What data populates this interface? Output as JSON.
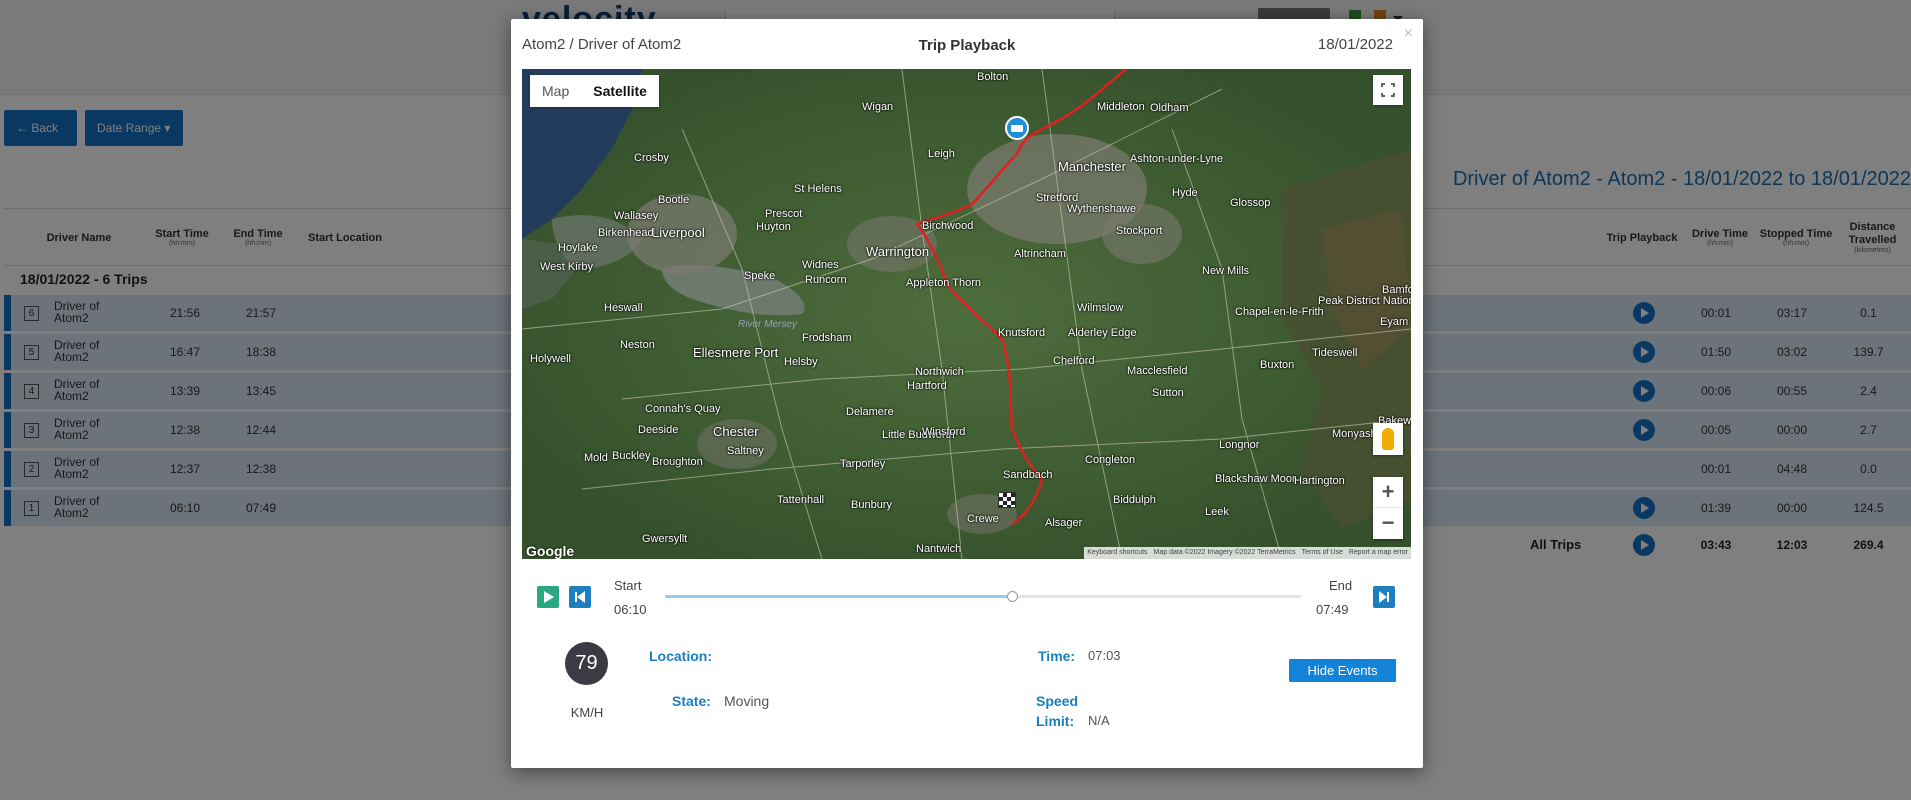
{
  "background": {
    "logo": "velocity",
    "top_button": "Logout",
    "back_button": "Back",
    "back_icon": "arrow-left-icon",
    "date_range_button": "Date Range",
    "report_title": "Driver of Atom2 - Atom2 - 18/01/2022 to 18/01/2022",
    "columns": {
      "driver_name": "Driver Name",
      "start_time": "Start Time",
      "end_time": "End Time",
      "time_unit": "(hh:mm)",
      "start_location": "Start Location",
      "trip_playback": "Trip Playback",
      "drive_time": "Drive Time",
      "stopped_time": "Stopped Time",
      "distance": "Distance Travelled",
      "distance_unit": "(kilometres)"
    },
    "group_label": "18/01/2022 - 6 Trips",
    "trips": [
      {
        "num": "6",
        "driver": "Driver of Atom2",
        "start": "21:56",
        "end": "21:57",
        "drive": "00:01",
        "stopped": "03:17",
        "distance": "0.1"
      },
      {
        "num": "5",
        "driver": "Driver of Atom2",
        "start": "16:47",
        "end": "18:38",
        "drive": "01:50",
        "stopped": "03:02",
        "distance": "139.7"
      },
      {
        "num": "4",
        "driver": "Driver of Atom2",
        "start": "13:39",
        "end": "13:45",
        "drive": "00:06",
        "stopped": "00:55",
        "distance": "2.4"
      },
      {
        "num": "3",
        "driver": "Driver of Atom2",
        "start": "12:38",
        "end": "12:44",
        "drive": "00:05",
        "stopped": "00:00",
        "distance": "2.7"
      },
      {
        "num": "2",
        "driver": "Driver of Atom2",
        "start": "12:37",
        "end": "12:38",
        "drive": "00:01",
        "stopped": "04:48",
        "distance": "0.0"
      },
      {
        "num": "1",
        "driver": "Driver of Atom2",
        "start": "06:10",
        "end": "07:49",
        "drive": "01:39",
        "stopped": "00:00",
        "distance": "124.5"
      }
    ],
    "totals": {
      "label": "All Trips",
      "drive": "03:43",
      "stopped": "12:03",
      "distance": "269.4"
    }
  },
  "modal": {
    "subtitle": "Atom2 / Driver of Atom2",
    "title": "Trip Playback",
    "date": "18/01/2022",
    "close_icon": "×",
    "map": {
      "toggle_map": "Map",
      "toggle_satellite": "Satellite",
      "active_view": "Satellite",
      "google_label": "Google",
      "attribution": {
        "shortcuts": "Keyboard shortcuts",
        "imagery": "Map data ©2022 Imagery ©2022 TerraMetrics",
        "terms": "Terms of Use",
        "report": "Report a map error"
      },
      "zoom_in": "+",
      "zoom_out": "−",
      "route_color": "#e02020",
      "places": {
        "bolton": "Bolton",
        "middleton": "Middleton",
        "oldham": "Oldham",
        "wigan": "Wigan",
        "manchester": "Manchester",
        "ashton": "Ashton-under-Lyne",
        "leigh": "Leigh",
        "crosby": "Crosby",
        "st_helens": "St Helens",
        "bootle": "Bootle",
        "stretford": "Stretford",
        "wallasey": "Wallasey",
        "liverpool": "Liverpool",
        "birkenhead": "Birkenhead",
        "prescot": "Prescot",
        "huyton": "Huyton",
        "warrington": "Warrington",
        "birchwood": "Birchwood",
        "stockport": "Stockport",
        "hyde": "Hyde",
        "glossop": "Glossop",
        "wythenshawe": "Wythenshawe",
        "hoylake": "Hoylake",
        "west_kirby": "West Kirby",
        "widnes": "Widnes",
        "altrincham": "Altrincham",
        "new_mills": "New Mills",
        "runcorn": "Runcorn",
        "speke": "Speke",
        "appleton": "Appleton Thorn",
        "wilmslow": "Wilmslow",
        "peak": "Peak District National Park",
        "chapel": "Chapel-en-le-Frith",
        "heswall": "Heswall",
        "river_mersey": "River Mersey",
        "frodsham": "Frodsham",
        "knutsford": "Knutsford",
        "alderley": "Alderley Edge",
        "buxton": "Buxton",
        "tideswell": "Tideswell",
        "neston": "Neston",
        "ellesmere": "Ellesmere Port",
        "helsby": "Helsby",
        "holywell": "Holywell",
        "northwich": "Northwich",
        "chelford": "Chelford",
        "macclesfield": "Macclesfield",
        "connahs": "Connah's Quay",
        "hartford": "Hartford",
        "sutton": "Sutton",
        "deeside": "Deeside",
        "chester": "Chester",
        "delamere": "Delamere",
        "little_budworth": "Little Budworth",
        "winsford": "Winsford",
        "mold": "Mold",
        "buckley": "Buckley",
        "saltney": "Saltney",
        "broughton": "Broughton",
        "tarporley": "Tarporley",
        "congleton": "Congleton",
        "sandbach": "Sandbach",
        "longnor": "Longnor",
        "tattenhall": "Tattenhall",
        "bunbury": "Bunbury",
        "biddulph": "Biddulph",
        "blackshaw": "Blackshaw Moor",
        "hartington": "Hartington",
        "leek": "Leek",
        "crewe": "Crewe",
        "alsager": "Alsager",
        "gwersyllt": "Gwersyllt",
        "nantwich": "Nantwich",
        "bakewell": "Bakewell",
        "monyash": "Monyash",
        "eyam": "Eyam",
        "bamford": "Bamford"
      }
    },
    "playback": {
      "start_label": "Start",
      "start_time": "06:10",
      "end_label": "End",
      "end_time": "07:49",
      "progress": 0.545
    },
    "speed": "79",
    "speed_unit": "KM/H",
    "location_label": "Location:",
    "location_value": "",
    "state_label": "State:",
    "state_value": "Moving",
    "time_label": "Time:",
    "time_value": "07:03",
    "speed_limit_label_1": "Speed",
    "speed_limit_label_2": "Limit:",
    "speed_limit_value": "N/A",
    "hide_events_button": "Hide Events"
  }
}
